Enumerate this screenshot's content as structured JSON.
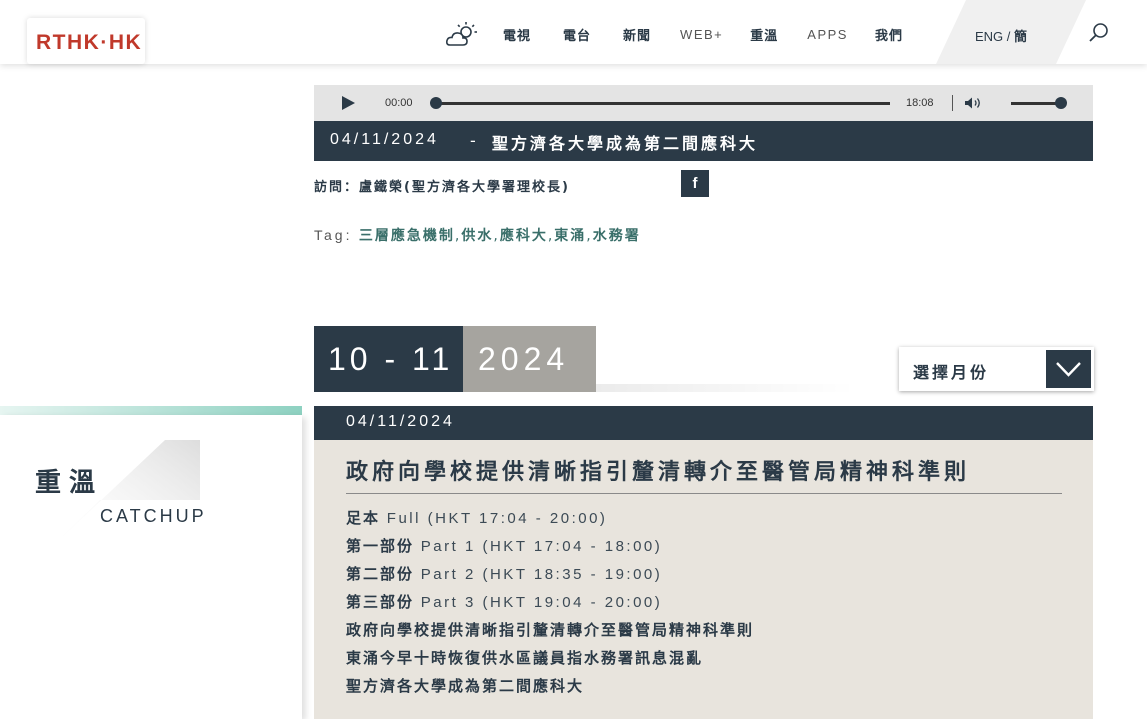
{
  "header": {
    "logo": "RTHK·HK",
    "nav": [
      {
        "label": "電視",
        "style": "bold"
      },
      {
        "label": "電台",
        "style": "bold"
      },
      {
        "label": "新聞",
        "style": "bold"
      },
      {
        "label": "WEB+",
        "style": "light"
      },
      {
        "label": "重溫",
        "style": "bold"
      },
      {
        "label": "APPS",
        "style": "light"
      },
      {
        "label": "我們",
        "style": "bold"
      }
    ],
    "lang_en": "ENG",
    "lang_sep": "/",
    "lang_zh": "簡",
    "icons": [
      "weather-icon",
      "search-icon"
    ]
  },
  "player": {
    "current_time": "00:00",
    "total_time": "18:08",
    "progress_fraction": 0.0,
    "volume_fraction": 1.0
  },
  "episode": {
    "date": "04/11/2024",
    "separator": "-",
    "title": "聖方濟各大學成為第二間應科大",
    "interview": "訪問：盧鐵榮(聖方濟各大學署理校長)",
    "facebook": "f"
  },
  "tags": {
    "label": "Tag:",
    "items": [
      "三層應急機制",
      "供水",
      "應科大",
      "東涌",
      "水務署"
    ]
  },
  "month": {
    "range": "10 - 11",
    "year": "2024",
    "select_label": "選擇月份"
  },
  "sidebar": {
    "title_zh": "重溫",
    "title_en": "CATCHUP"
  },
  "card": {
    "date": "04/11/2024",
    "title": "政府向學校提供清晰指引釐清轉介至醫管局精神科準則",
    "segments": [
      {
        "zh": "足本",
        "en": "Full (HKT 17:04 - 20:00)"
      },
      {
        "zh": "第一部份",
        "en": "Part 1 (HKT 17:04 - 18:00)"
      },
      {
        "zh": "第二部份",
        "en": "Part 2 (HKT 18:35 - 19:00)"
      },
      {
        "zh": "第三部份",
        "en": "Part 3 (HKT 19:04 - 20:00)"
      }
    ],
    "stories": [
      "政府向學校提供清晰指引釐清轉介至醫管局精神科準則",
      "東涌今早十時恢復供水區議員指水務署訊息混亂",
      "聖方濟各大學成為第二間應科大"
    ]
  },
  "colors": {
    "navy": "#2b3a47",
    "brand_red": "#c0392b",
    "card_bg": "#e8e4dd",
    "tag_teal": "#3a6f6a",
    "year_gray": "#a6a49f"
  }
}
